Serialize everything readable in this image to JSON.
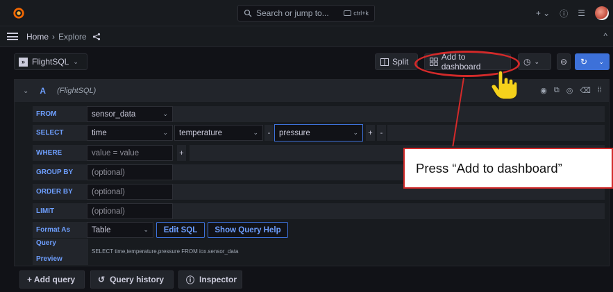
{
  "topbar": {
    "search_placeholder": "Search or jump to...",
    "search_shortcut": "ctrl+k",
    "plus_menu": "+",
    "icons": [
      "help-icon",
      "rss-icon",
      "avatar"
    ]
  },
  "breadcrumb": {
    "home": "Home",
    "separator": "›",
    "current": "Explore"
  },
  "toolbar": {
    "datasource": "FlightSQL",
    "split_label": "Split",
    "add_to_dashboard_label": "Add to dashboard"
  },
  "query": {
    "letter": "A",
    "datasource": "(FlightSQL)",
    "from_label": "FROM",
    "from_value": "sensor_data",
    "select_label": "SELECT",
    "select_columns": [
      "time",
      "temperature",
      "pressure"
    ],
    "where_label": "WHERE",
    "where_value": "value = value",
    "group_by_label": "GROUP BY",
    "order_by_label": "ORDER BY",
    "limit_label": "LIMIT",
    "optional_placeholder": "(optional)",
    "format_as_label": "Format As",
    "format_value": "Table",
    "edit_sql_label": "Edit SQL",
    "show_help_label": "Show Query Help",
    "preview_label_1": "Query",
    "preview_label_2": "Preview",
    "preview_sql": "SELECT time,temperature,pressure FROM iox.sensor_data",
    "plus": "+",
    "minus": "-"
  },
  "bottom": {
    "add_query": "+ Add query",
    "query_history": "Query history",
    "inspector": "Inspector"
  },
  "annotation": {
    "callout_text": "Press “Add to dashboard”",
    "accent_color": "#d32a2a"
  },
  "colors": {
    "brand_blue": "#3d71d9",
    "label_blue": "#6e9fff",
    "bg": "#111217"
  }
}
